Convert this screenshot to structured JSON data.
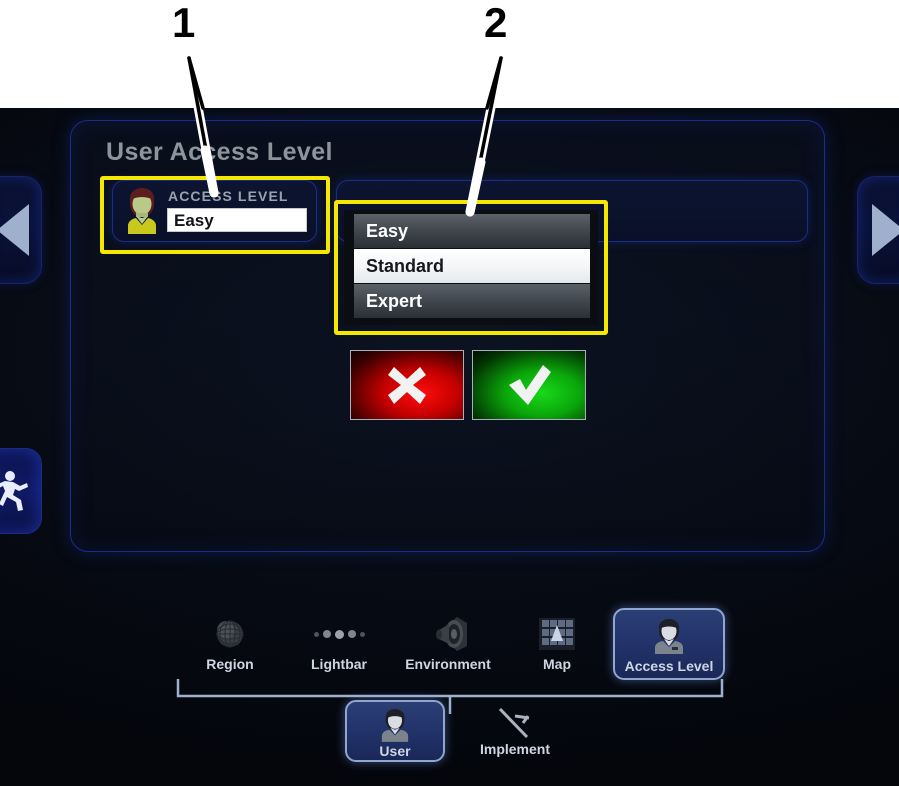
{
  "annotations": [
    {
      "id": "callout-1",
      "label": "1",
      "target": "access-level-field"
    },
    {
      "id": "callout-2",
      "label": "2",
      "target": "access-level-dropdown-list"
    }
  ],
  "screen": {
    "page_title": "User Access Level",
    "nav_left_icon": "triangle-left-icon",
    "nav_right_icon": "triangle-right-icon",
    "status_icon": "running-person-icon"
  },
  "access_level_field": {
    "icon": "user-avatar-icon",
    "label": "ACCESS LEVEL",
    "value": "Easy",
    "highlight_color": "#f5e800"
  },
  "dropdown": {
    "options": [
      {
        "label": "Easy",
        "state": "selected-dark"
      },
      {
        "label": "Standard",
        "state": "highlighted-light"
      },
      {
        "label": "Expert",
        "state": "normal-dark"
      }
    ],
    "cancel_icon": "cross-icon",
    "confirm_icon": "check-icon",
    "cancel_color": "#d00000",
    "confirm_color": "#0aa60a",
    "highlight_color": "#f5e800"
  },
  "bottom_nav": {
    "items": [
      {
        "label": "Region",
        "icon": "globe-icon",
        "selected": false
      },
      {
        "label": "Lightbar",
        "icon": "dots-icon",
        "selected": false
      },
      {
        "label": "Environment",
        "icon": "speaker-icon",
        "selected": false
      },
      {
        "label": "Map",
        "icon": "grid-map-icon",
        "selected": false
      },
      {
        "label": "Access Level",
        "icon": "person-icon",
        "selected": true
      }
    ]
  },
  "bottom_tabs": {
    "items": [
      {
        "label": "User",
        "icon": "person-icon",
        "selected": true
      },
      {
        "label": "Implement",
        "icon": "implement-icon",
        "selected": false
      }
    ]
  },
  "colors": {
    "accent_blue": "#2b3f75",
    "border_blue": "#1b2d8c",
    "highlight_yellow": "#f5e800",
    "text_grey": "#8c949c"
  }
}
